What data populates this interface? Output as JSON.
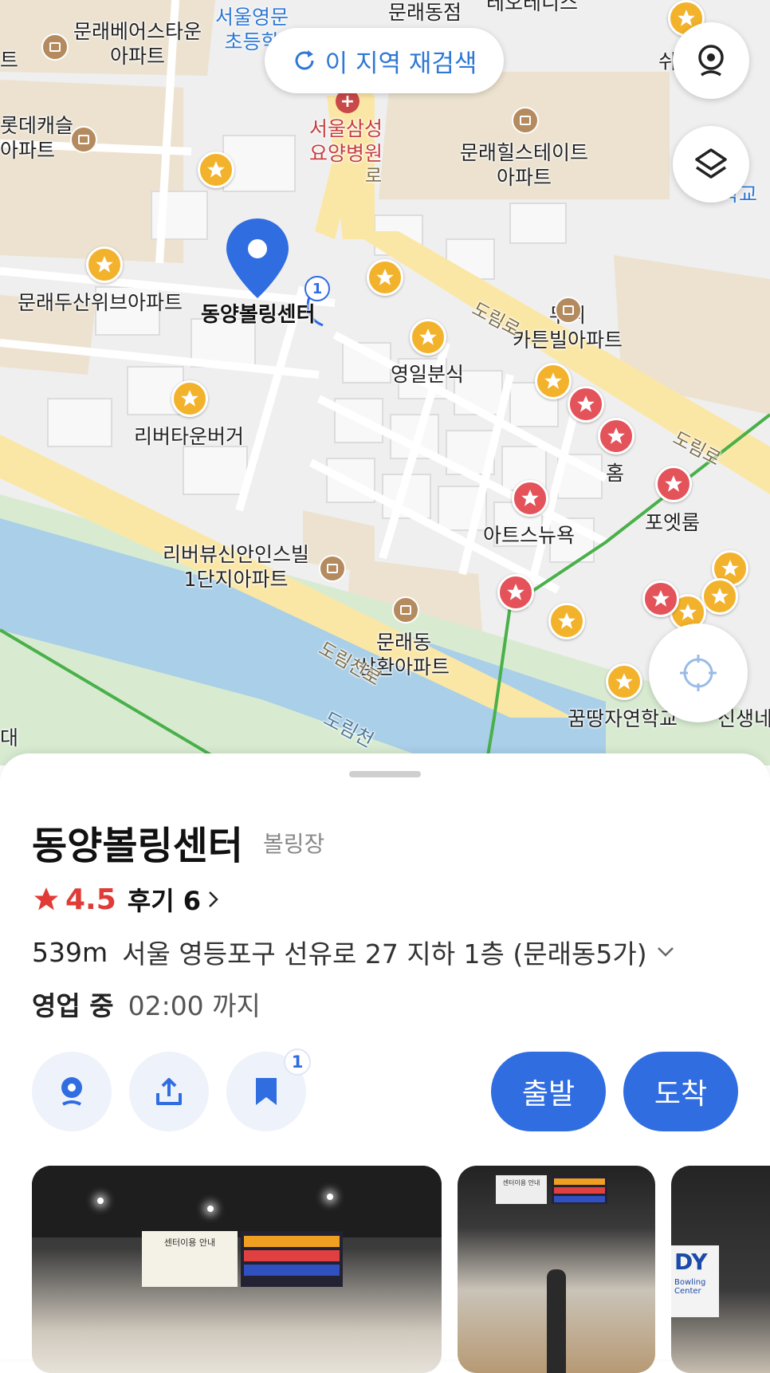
{
  "map": {
    "research_label": "이 지역 재검색",
    "selected_pin_label": "동양볼링센터",
    "route_badge": "1",
    "labels": {
      "mullae_bestown": "문래베어스타운\n아파트",
      "seoul_yeongmun": "서울영문\n초등학",
      "starbucks": "문래동점",
      "tennis": "테오테니스",
      "swi": "쉬",
      "hyundai": "트",
      "lotte_castle": "롯데캐슬\n아파트",
      "samsung_hospital": "서울삼성\n요양병원",
      "hills_state": "문래힐스테이트\n아파트",
      "school_r": "학교",
      "doosan_weve": "문래두산위브아파트",
      "murae_carten": "무리\n카튼빌아파트",
      "youngil": "영일분식",
      "rivertown": "리버타운버거",
      "home": "홈",
      "arts_newyork": "아트스뉴욕",
      "poetroom": "포엣룸",
      "riverview": "리버뷰신안인스빌\n1단지아파트",
      "samhwan": "문래동\n삼환아파트",
      "kkumttang": "꿈땅자연학교",
      "sinsaengne": "신생네",
      "dae": "대",
      "doriro_1": "도림로",
      "doriro_2": "도림로",
      "doriro_3": "로",
      "dorimcheon_ro": "도림천로",
      "dorimcheon": "도림천"
    }
  },
  "place": {
    "name": "동양볼링센터",
    "category": "볼링장",
    "rating": "4.5",
    "reviews": "후기 6",
    "distance": "539m",
    "address": "서울 영등포구 선유로 27 지하 1층 (문래동5가)",
    "status": "영업 중",
    "hours": "02:00 까지",
    "save_count": "1",
    "depart_label": "출발",
    "arrive_label": "도착"
  },
  "photos": {
    "p1_sign": "센터이용 안내",
    "p2_sign": "센터이용 안내",
    "p3_sign": "DY",
    "p3_sub": "Bowling Center"
  },
  "colors": {
    "accent": "#2f6de1",
    "star_red": "#e03b37",
    "pin_yellow": "#f3b22b",
    "pin_red": "#e4525a"
  }
}
